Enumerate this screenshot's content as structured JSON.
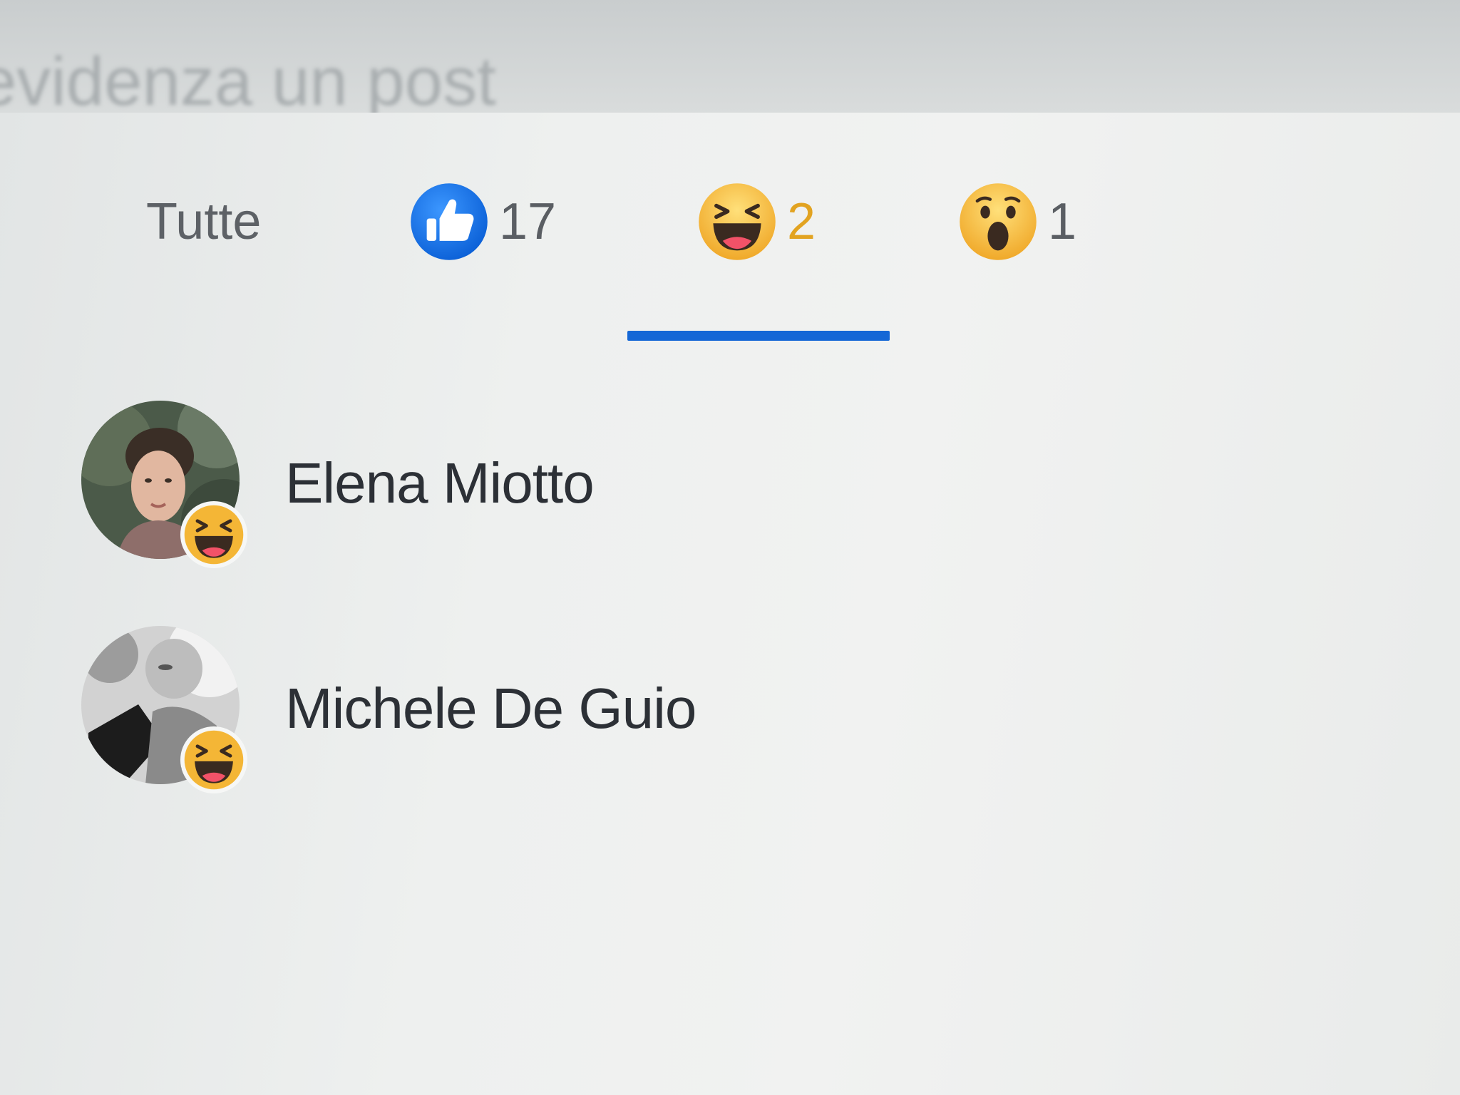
{
  "background_header": {
    "text": "evidenza un post"
  },
  "tabs": {
    "all_label": "Tutte",
    "like": {
      "icon": "like-icon",
      "count": "17",
      "color": "#1877f2"
    },
    "haha": {
      "icon": "haha-icon",
      "count": "2",
      "color": "#e2a321",
      "selected": true
    },
    "wow": {
      "icon": "wow-icon",
      "count": "1"
    }
  },
  "people": [
    {
      "name": "Elena Miotto",
      "reaction": "haha-icon"
    },
    {
      "name": "Michele De Guio",
      "reaction": "haha-icon"
    }
  ],
  "colors": {
    "accent": "#1467d6",
    "emoji_yellow": "#f7c23e",
    "name_text": "#2c3036"
  }
}
